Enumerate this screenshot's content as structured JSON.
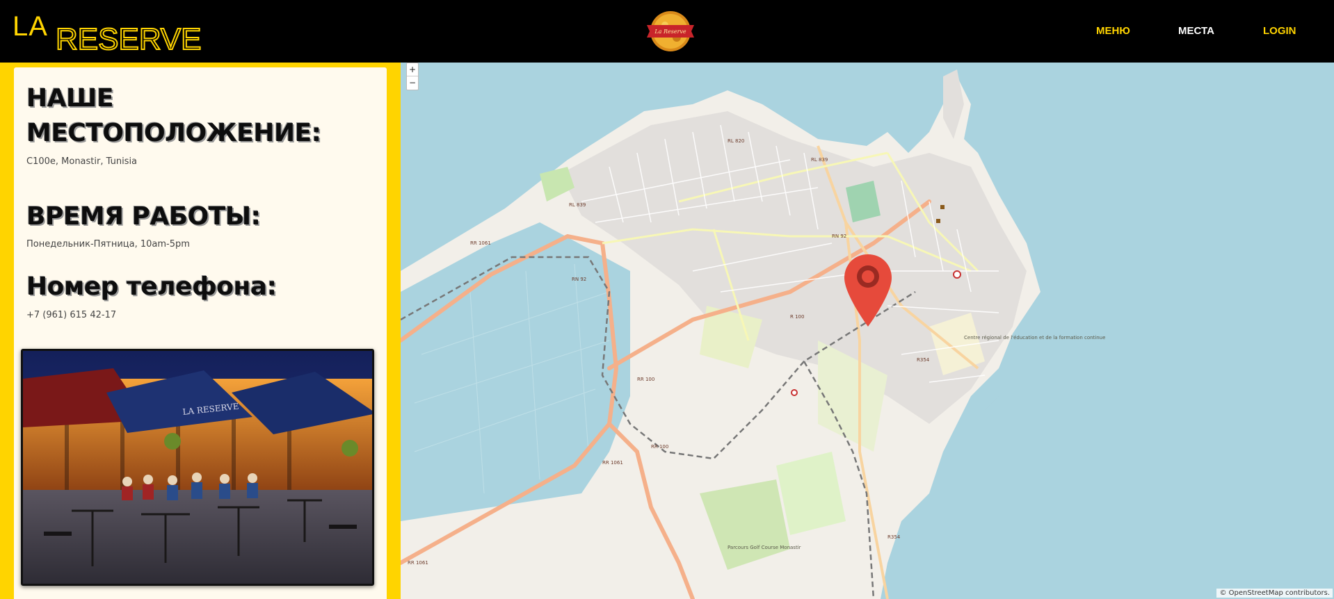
{
  "header": {
    "brand_la": "LA",
    "brand_reserve": "RESERVE",
    "logo_text": "La Reserve",
    "nav": {
      "menu": "МЕНЮ",
      "places": "МЕСТА",
      "login": "LOGIN"
    }
  },
  "info": {
    "location_title": "НАШЕ МЕСТОПОЛОЖЕНИЕ:",
    "address": "C100e, Monastir, Tunisia",
    "hours_title": "ВРЕМЯ РАБОТЫ:",
    "hours": "Понедельник-Пятница, 10am-5pm",
    "phone_title": "Номер телефона:",
    "phone": "+7 (961) 615 42-17",
    "photo_sign": "LA RESERVE"
  },
  "map": {
    "zoom_in": "+",
    "zoom_out": "−",
    "attribution": "© OpenStreetMap contributors.",
    "road_labels": [
      "RL 839",
      "RN 92",
      "RR 100",
      "RR 1061",
      "R 100",
      "RN 92",
      "RL 820",
      "RL 839",
      "RR 1061",
      "RR 100",
      "RR 1061",
      "R354",
      "R354"
    ],
    "place_labels": [
      "Centre régional de l'éducation et de la formation continue",
      "Parcours Golf Course Monastir"
    ]
  },
  "colors": {
    "accent_yellow": "#ffd400",
    "header_bg": "#000000",
    "panel_bg": "#fffaee",
    "water": "#aad3df",
    "land": "#f2efe9",
    "marker": "#e64a3b"
  }
}
